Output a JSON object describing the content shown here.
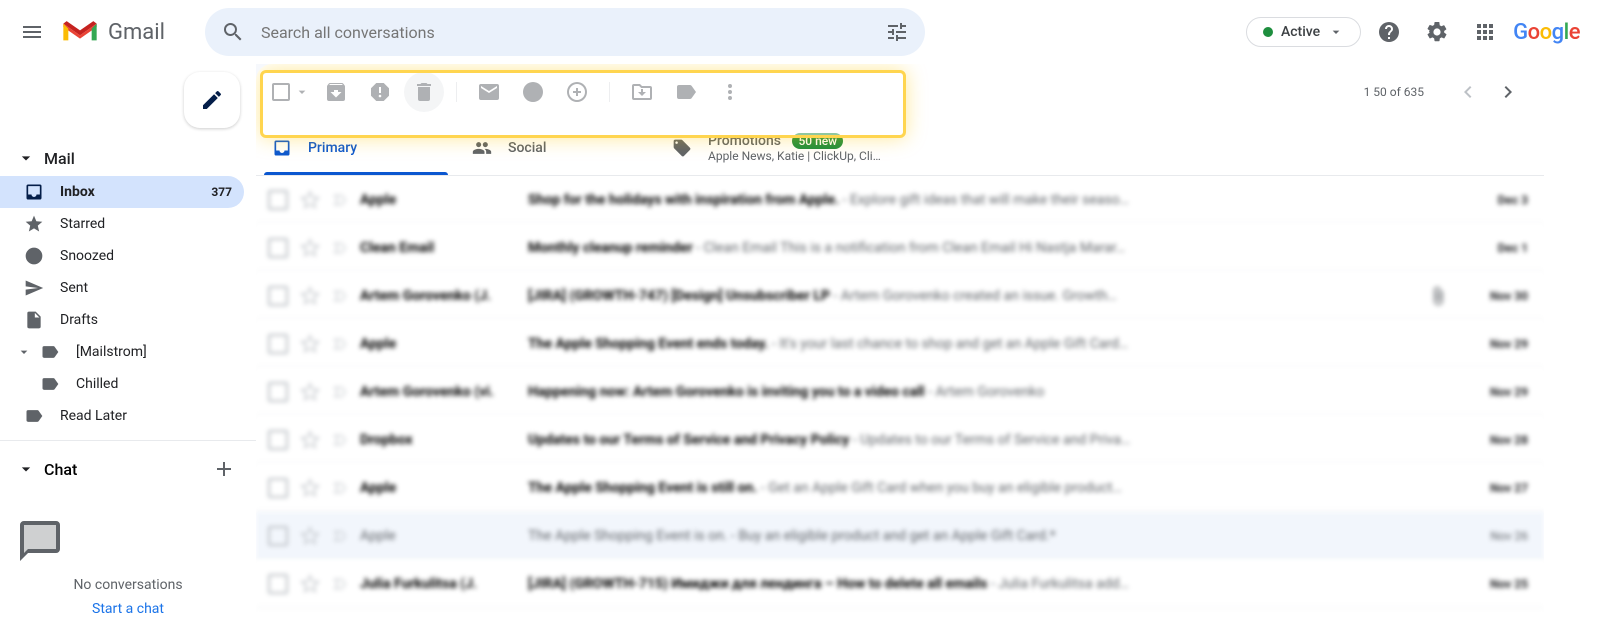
{
  "colors": {
    "accent": "#0b57d0",
    "highlight": "#ffd54f",
    "active_green": "#1e8e3e",
    "text_muted": "#5f6368"
  },
  "header": {
    "logo_text": "Gmail",
    "search_placeholder": "Search all conversations",
    "status_label": "Active"
  },
  "page_info": "1 50 of 635",
  "sidebar": {
    "mail_section": "Mail",
    "chat_section": "Chat",
    "items": [
      {
        "label": "Inbox",
        "count": "377",
        "icon": "inbox"
      },
      {
        "label": "Starred",
        "icon": "star"
      },
      {
        "label": "Snoozed",
        "icon": "clock"
      },
      {
        "label": "Sent",
        "icon": "send"
      },
      {
        "label": "Drafts",
        "icon": "draft"
      },
      {
        "label": "[Mailstrom]",
        "icon": "label"
      },
      {
        "label": "Chilled",
        "icon": "label",
        "sub": true
      },
      {
        "label": "Read Later",
        "icon": "label"
      }
    ],
    "no_conversations": "No conversations",
    "start_chat": "Start a chat"
  },
  "tabs": {
    "primary": "Primary",
    "social": "Social",
    "promotions": "Promotions",
    "promo_badge": "50 new",
    "promo_sub": "Apple News, Katie | ClickUp, Cli…"
  },
  "emails": [
    {
      "sender": "Apple",
      "subject": "Shop for the holidays with inspiration from Apple.",
      "snippet": " - Explore gift ideas that will make their seaso…",
      "date": "Dec 3",
      "unread": true,
      "blur": true
    },
    {
      "sender": "Clean Email",
      "subject": "Monthly cleanup reminder",
      "snippet": " - Clean Email This is a notification from Clean Email Hi Nastja Marar…",
      "date": "Dec 1",
      "unread": true,
      "blur": true
    },
    {
      "sender": "Artem Gorovenko (J.",
      "subject": "[JIRA] (GROWTH-747) [Design] Unsubscriber LP",
      "snippet": " - Artem Gorovenko created an issue. Growth…",
      "date": "Nov 30",
      "unread": true,
      "blur": true,
      "attach": true
    },
    {
      "sender": "Apple",
      "subject": "The Apple Shopping Event ends today.",
      "snippet": " - It's your last chance to shop and get an Apple Gift Card…",
      "date": "Nov 29",
      "unread": true,
      "blur": true
    },
    {
      "sender": "Artem Gorovenko (vi.",
      "subject": "Happening now: Artem Gorovenko is inviting you to a video call",
      "snippet": " - Artem Gorovenko <artem@ct…",
      "date": "Nov 29",
      "unread": true,
      "blur": true
    },
    {
      "sender": "Dropbox",
      "subject": "Updates to our Terms of Service and Privacy Policy",
      "snippet": " - Updates to our Terms of Service and Priva…",
      "date": "Nov 28",
      "unread": true,
      "blur": true
    },
    {
      "sender": "Apple",
      "subject": "The Apple Shopping Event is still on.",
      "snippet": " - Get an Apple Gift Card when you buy an eligible product…",
      "date": "Nov 27",
      "unread": true,
      "blur": true
    },
    {
      "sender": "Apple",
      "subject": "The Apple Shopping Event is on.",
      "snippet": " - Buy an eligible product and get an Apple Gift Card.* ",
      "date": "Nov 26",
      "unread": false,
      "blur": true
    },
    {
      "sender": "Julia Furkulitsa (J.",
      "subject": "[JIRA] (GROWTH-715) Имиджи для лендинга – How to delete all emails",
      "snippet": " - Julia Furkulitsa add…",
      "date": "Nov 25",
      "unread": true,
      "blur": true
    }
  ]
}
